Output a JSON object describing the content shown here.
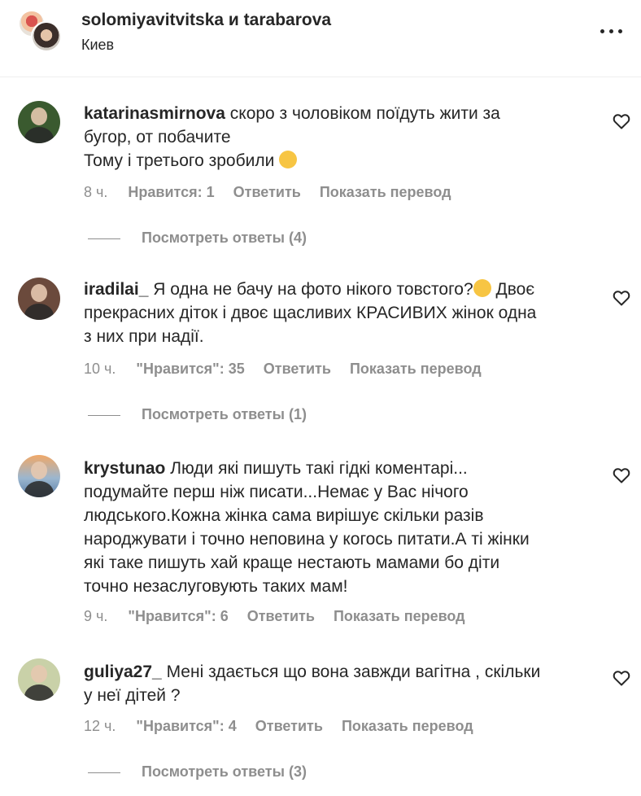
{
  "header": {
    "title": "solomiyavitvitska и tarabarova",
    "location": "Киев"
  },
  "comments": [
    {
      "username": "katarinasmirnova",
      "text_lines": [
        "скоро з чоловіком поїдуть жити за",
        "бугор, от побачите",
        "Тому і третього зробили"
      ],
      "emoji": "smirk-emoji",
      "time": "8 ч.",
      "likes": "Нравится: 1",
      "reply": "Ответить",
      "translate": "Показать перевод",
      "view_replies": "Посмотреть ответы (4)"
    },
    {
      "username": "iradilai_",
      "text_lines": [
        "Я одна не бачу на фото нікого товстого?",
        "прекрасних діток і двоє щасливих КРАСИВИХ жінок одна",
        "з них при надії."
      ],
      "line1_after_emoji": "Двоє",
      "emoji": "tears-of-joy-emoji",
      "time": "10 ч.",
      "likes": "\"Нравится\": 35",
      "reply": "Ответить",
      "translate": "Показать перевод",
      "view_replies": "Посмотреть ответы (1)"
    },
    {
      "username": "krystunao",
      "text_lines": [
        "Люди які пишуть такі гідкі коментарі...",
        "подумайте перш ніж писати...Немає у Вас нічого",
        "людського.Кожна жінка сама вирішує скільки разів",
        "народжувати і точно неповина у когось питати.А ті жінки",
        "які таке пишуть хай краще нестають мамами бо діти",
        "точно незаслуговують таких мам!"
      ],
      "time": "9 ч.",
      "likes": "\"Нравится\": 6",
      "reply": "Ответить",
      "translate": "Показать перевод"
    },
    {
      "username": "guliya27_",
      "text_lines": [
        "Мені здається що вона завжди вагітна , скільки",
        "у неї дітей ?"
      ],
      "time": "12 ч.",
      "likes": "\"Нравится\": 4",
      "reply": "Ответить",
      "translate": "Показать перевод",
      "view_replies": "Посмотреть ответы (3)"
    }
  ],
  "colors": {
    "text": "#262626",
    "secondary": "#8e8e8e",
    "divider": "#efefef"
  }
}
